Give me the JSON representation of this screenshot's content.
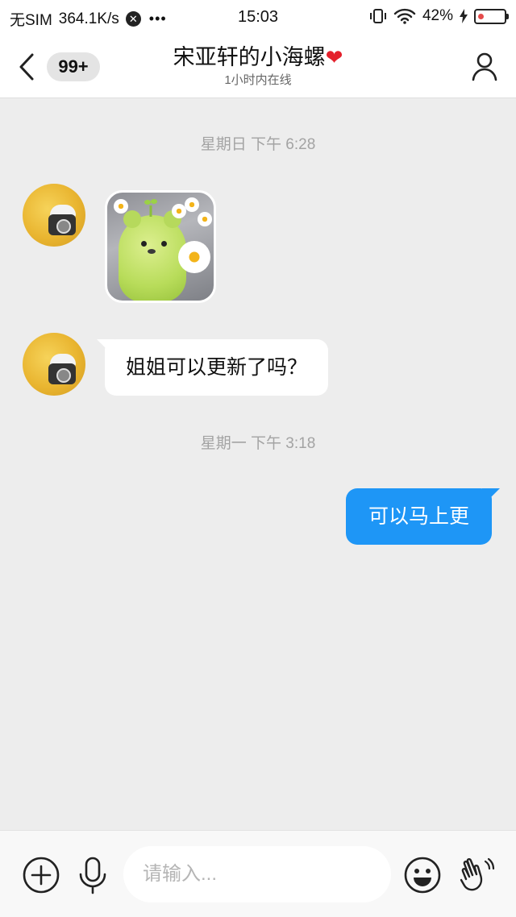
{
  "status_bar": {
    "carrier": "无SIM",
    "speed": "364.1K/s",
    "notif_glyph": "✕",
    "more": "•••",
    "time": "15:03",
    "battery": "42%"
  },
  "header": {
    "unread_badge": "99+",
    "title": "宋亚轩的小海螺",
    "title_emoji": "❤",
    "subtitle": "1小时内在线"
  },
  "messages": {
    "ts1": "星期日 下午 6:28",
    "incoming_text": "姐姐可以更新了吗？",
    "ts2": "星期一 下午 3:18",
    "outgoing_text": "可以马上更"
  },
  "input_bar": {
    "placeholder": "请输入..."
  },
  "colors": {
    "accent": "#1e96f6",
    "background": "#ededed"
  },
  "icons": [
    "back-chevron-icon",
    "profile-icon",
    "plus-icon",
    "mic-icon",
    "smiley-icon",
    "hand-wave-icon",
    "vibrate-icon",
    "wifi-icon",
    "charging-icon",
    "battery-icon"
  ]
}
